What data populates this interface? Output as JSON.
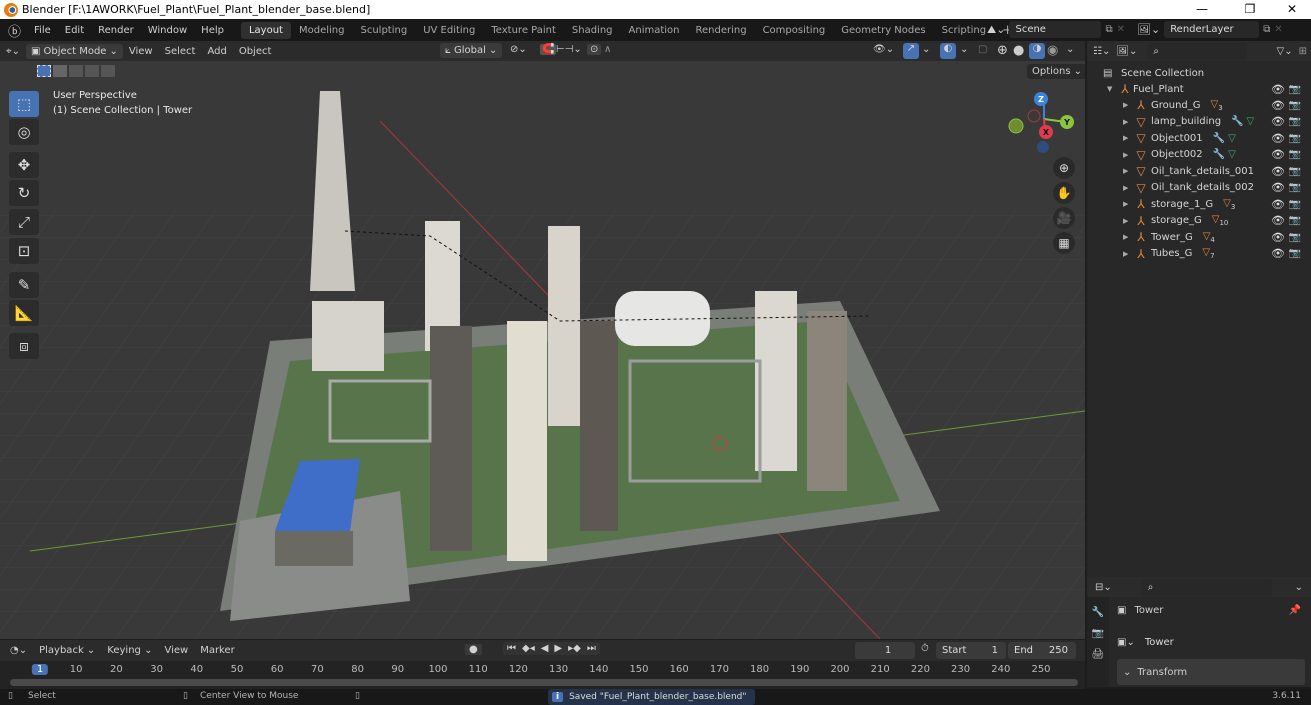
{
  "window": {
    "title": "Blender [F:\\1AWORK\\Fuel_Plant\\Fuel_Plant_blender_base.blend]",
    "minimize": "—",
    "maximize": "❐",
    "close": "✕"
  },
  "menu": [
    "File",
    "Edit",
    "Render",
    "Window",
    "Help"
  ],
  "workspaces": [
    {
      "label": "Layout",
      "active": true
    },
    {
      "label": "Modeling"
    },
    {
      "label": "Sculpting"
    },
    {
      "label": "UV Editing"
    },
    {
      "label": "Texture Paint"
    },
    {
      "label": "Shading"
    },
    {
      "label": "Animation"
    },
    {
      "label": "Rendering"
    },
    {
      "label": "Compositing"
    },
    {
      "label": "Geometry Nodes"
    },
    {
      "label": "Scripting"
    }
  ],
  "add_workspace": "+",
  "scene": {
    "name": "Scene",
    "render_layer": "RenderLayer"
  },
  "viewport_header": {
    "mode": "Object Mode",
    "menus": [
      "View",
      "Select",
      "Add",
      "Object"
    ],
    "orientation": "Global",
    "options": "Options"
  },
  "viewport_overlay": {
    "line1": "User Perspective",
    "line2": "(1) Scene Collection | Tower"
  },
  "gizmo": {
    "z": "Z",
    "y": "Y",
    "x": "X"
  },
  "outliner": {
    "root": "Scene Collection",
    "collection": "Fuel_Plant",
    "items": [
      {
        "name": "Ground_G",
        "type": "empty",
        "badge": "3"
      },
      {
        "name": "lamp_building",
        "type": "mesh",
        "badge": ""
      },
      {
        "name": "Object001",
        "type": "mesh",
        "badge": ""
      },
      {
        "name": "Object002",
        "type": "mesh",
        "badge": ""
      },
      {
        "name": "Oil_tank_details_001",
        "type": "mesh",
        "badge": ""
      },
      {
        "name": "Oil_tank_details_002",
        "type": "mesh",
        "badge": ""
      },
      {
        "name": "storage_1_G",
        "type": "empty",
        "badge": "3"
      },
      {
        "name": "storage_G",
        "type": "empty",
        "badge": "10"
      },
      {
        "name": "Tower_G",
        "type": "empty",
        "badge": "4"
      },
      {
        "name": "Tubes_G",
        "type": "empty",
        "badge": "7"
      }
    ]
  },
  "properties": {
    "object_name": "Tower",
    "data_name": "Tower",
    "panel": "Transform"
  },
  "timeline": {
    "menus": [
      "Playback",
      "Keying",
      "View",
      "Marker"
    ],
    "current_frame": "1",
    "start_label": "Start",
    "start": "1",
    "end_label": "End",
    "end": "250",
    "ticks": [
      "1",
      "10",
      "20",
      "30",
      "40",
      "50",
      "60",
      "70",
      "80",
      "90",
      "100",
      "110",
      "120",
      "130",
      "140",
      "150",
      "160",
      "170",
      "180",
      "190",
      "200",
      "210",
      "220",
      "230",
      "240",
      "250"
    ]
  },
  "status": {
    "select": "Select",
    "center": "Center View to Mouse",
    "message": "Saved \"Fuel_Plant_blender_base.blend\"",
    "version": "3.6.11"
  },
  "colors": {
    "accent": "#4772b3",
    "object_orange": "#e08a3b",
    "x_axis": "#e03a4f",
    "y_axis": "#8bc53f",
    "z_axis": "#3c84d8"
  }
}
